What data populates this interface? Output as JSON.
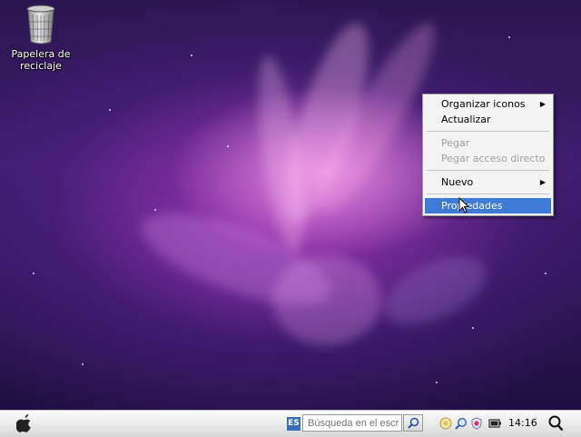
{
  "desktop": {
    "icons": [
      {
        "label_line1": "Papelera de",
        "label_line2": "reciclaje",
        "icon": "recycle-bin-icon"
      }
    ]
  },
  "context_menu": {
    "items": [
      {
        "label": "Organizar iconos",
        "submenu": true,
        "enabled": true
      },
      {
        "label": "Actualizar",
        "submenu": false,
        "enabled": true
      },
      {
        "label": "Pegar",
        "submenu": false,
        "enabled": false
      },
      {
        "label": "Pegar acceso directo",
        "submenu": false,
        "enabled": false
      },
      {
        "label": "Nuevo",
        "submenu": true,
        "enabled": true
      },
      {
        "label": "Propiedades",
        "submenu": false,
        "enabled": true,
        "highlighted": true
      }
    ],
    "submenu_arrow": "▶"
  },
  "taskbar": {
    "start_icon": "apple-icon",
    "language_indicator": "ES",
    "search": {
      "placeholder": "Búsqueda en el escritorio"
    },
    "tray_icons": [
      "network-icon",
      "zoom-icon",
      "security-icon",
      "battery-icon"
    ],
    "clock": "14:16",
    "spotlight_icon": "magnifier-icon"
  },
  "colors": {
    "menu_highlight": "#3d7bd6",
    "menu_background": "#f3f3f3",
    "wallpaper_accent": "#c04ac8"
  }
}
